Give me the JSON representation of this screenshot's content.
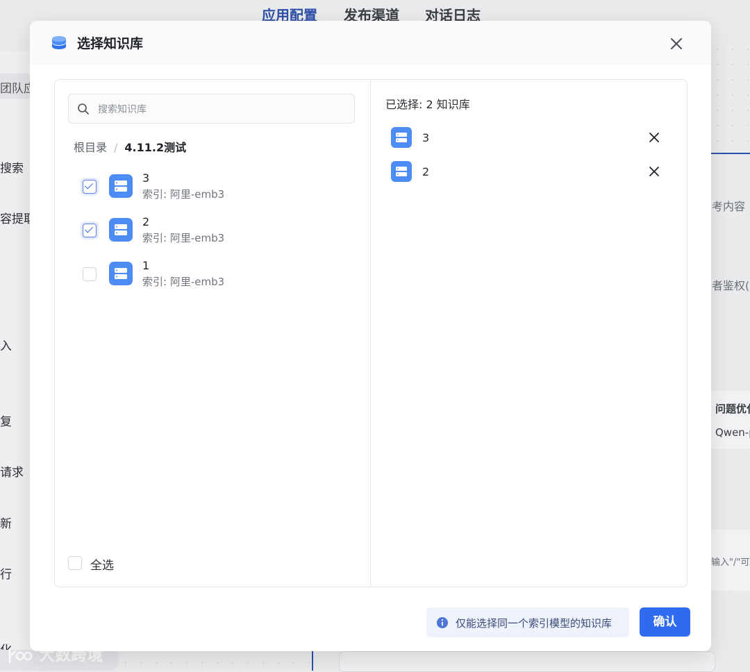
{
  "background": {
    "tabs": [
      "应用配置",
      "发布渠道",
      "对话日志"
    ],
    "left_items": [
      "团队应",
      "搜索",
      "容提取",
      "入",
      "复",
      "请求",
      "新",
      "行",
      "化"
    ],
    "right_items": [
      "考内容",
      "者鉴权(",
      "问题优化",
      "Qwen-p",
      "输入\"/\"可"
    ],
    "watermark": "大数跨境"
  },
  "modal": {
    "title": "选择知识库",
    "search": {
      "placeholder": "搜索知识库"
    },
    "breadcrumb": {
      "root": "根目录",
      "separator": "/",
      "current": "4.11.2测试"
    },
    "items": [
      {
        "name": "3",
        "meta": "索引: 阿里-emb3",
        "checked": true
      },
      {
        "name": "2",
        "meta": "索引: 阿里-emb3",
        "checked": true
      },
      {
        "name": "1",
        "meta": "索引: 阿里-emb3",
        "checked": false
      }
    ],
    "select_all_label": "全选",
    "selected_header": "已选择: 2 知识库",
    "selected": [
      {
        "name": "3"
      },
      {
        "name": "2"
      }
    ],
    "tip": "仅能选择同一个索引模型的知识库",
    "confirm_label": "确认"
  },
  "colors": {
    "accent": "#2f6bf0",
    "kb_icon": "#4e8cf5",
    "tip_bg": "#eef2fb"
  }
}
